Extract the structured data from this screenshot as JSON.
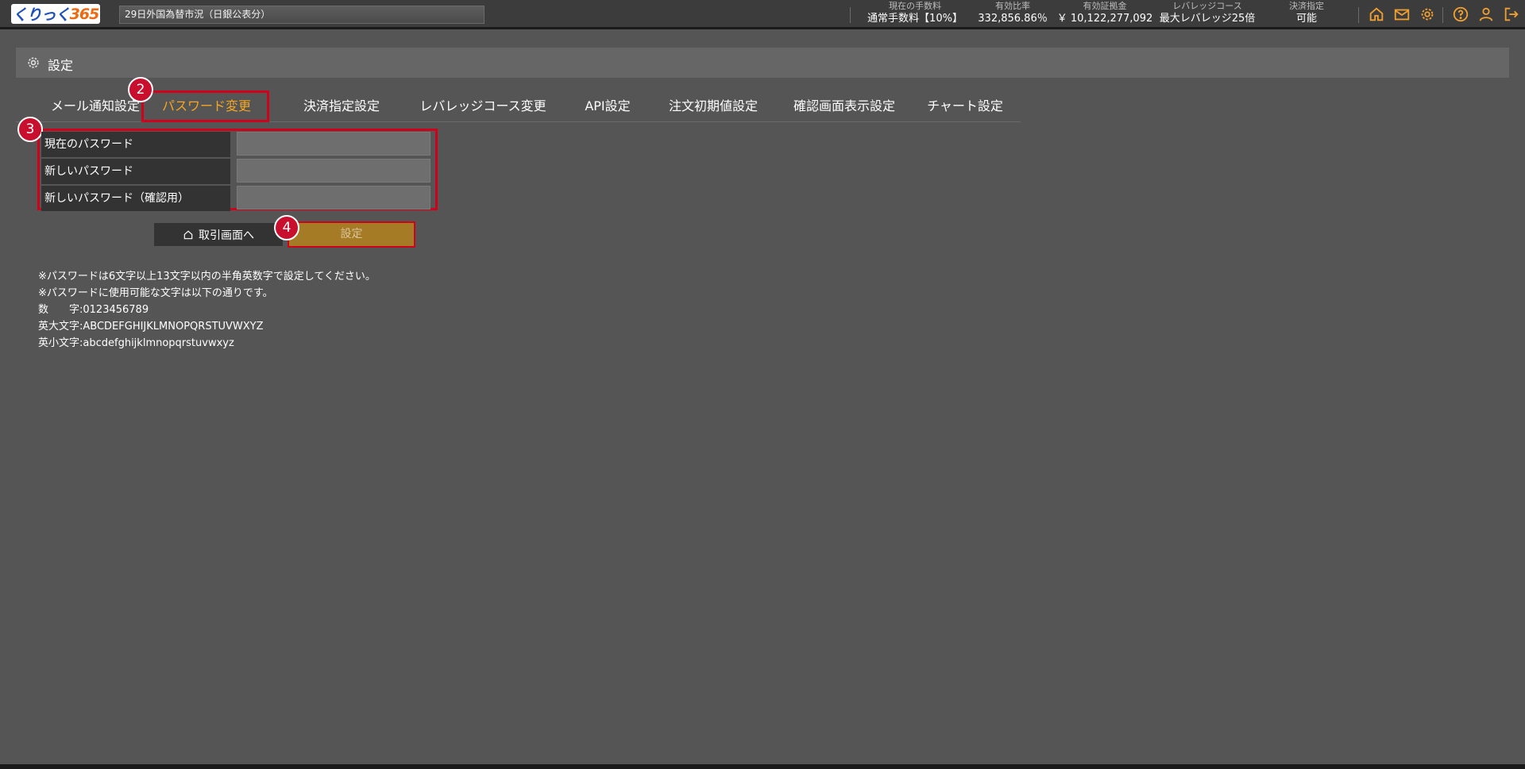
{
  "app": {
    "logo_text": "くりっく",
    "logo_num": "365",
    "ticker": "29日外国為替市況（日銀公表分）"
  },
  "stats": [
    {
      "label": "現在の手数料",
      "value": "通常手数料【10%】"
    },
    {
      "label": "有効比率",
      "value": "332,856.86％"
    },
    {
      "label": "有効証拠金",
      "value": "￥ 10,122,277,092"
    },
    {
      "label": "レバレッジコース",
      "value": "最大レバレッジ25倍"
    },
    {
      "label": "決済指定",
      "value": "可能"
    }
  ],
  "header_icons": [
    "home-icon",
    "mail-icon",
    "settings-icon",
    "help-icon",
    "user-icon",
    "logout-icon"
  ],
  "accent_color": "#f0a030",
  "section": {
    "title": "設定"
  },
  "tabs": [
    {
      "label": "メール通知設定",
      "active": false
    },
    {
      "label": "パスワード変更",
      "active": true
    },
    {
      "label": "決済指定設定",
      "active": false
    },
    {
      "label": "レバレッジコース変更",
      "active": false
    },
    {
      "label": "API設定",
      "active": false
    },
    {
      "label": "注文初期値設定",
      "active": false
    },
    {
      "label": "確認画面表示設定",
      "active": false
    },
    {
      "label": "チャート設定",
      "active": false
    }
  ],
  "form": {
    "current_password_label": "現在のパスワード",
    "new_password_label": "新しいパスワード",
    "confirm_password_label": "新しいパスワード（確認用）",
    "current_password_value": "",
    "new_password_value": "",
    "confirm_password_value": ""
  },
  "buttons": {
    "back_label": "取引画面へ",
    "submit_label": "設定"
  },
  "badges": {
    "b2": "2",
    "b3": "3",
    "b4": "4"
  },
  "notes": {
    "line1": "※パスワードは6文字以上13文字以内の半角英数字で設定してください。",
    "line2": "※パスワードに使用可能な文字は以下の通りです。",
    "digits_label": "数　　字:",
    "digits_value": "0123456789",
    "upper_label": "英大文字:",
    "upper_value": "ABCDEFGHIJKLMNOPQRSTUVWXYZ",
    "lower_label": "英小文字:",
    "lower_value": "abcdefghijklmnopqrstuvwxyz"
  }
}
